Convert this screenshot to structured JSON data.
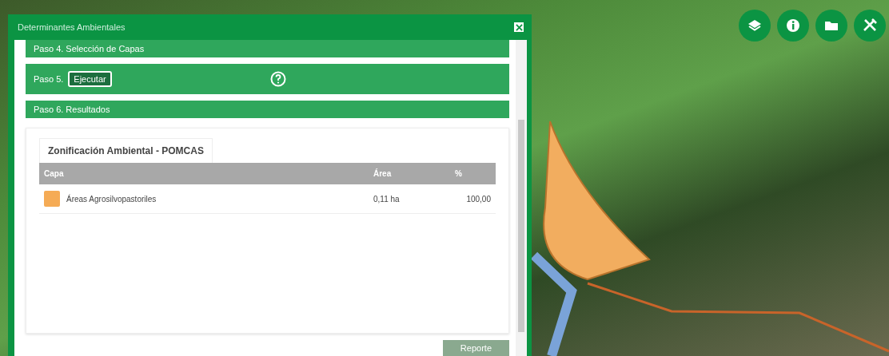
{
  "window": {
    "title": "Determinantes Ambientales"
  },
  "steps": [
    {
      "label": "Paso 4. Selección de Capas"
    },
    {
      "label": "Paso 5.",
      "button": "Ejecutar",
      "help": true
    },
    {
      "label": "Paso 6. Resultados"
    }
  ],
  "results": {
    "tab": "Zonificación Ambiental - POMCAS",
    "columns": [
      "Capa",
      "Área",
      "%"
    ],
    "rows": [
      {
        "color": "#f5ab55",
        "capa": "Áreas Agrosilvopastoriles",
        "area": "0,11 ha",
        "percent": "100,00"
      }
    ]
  },
  "report_button": "Reporte"
}
